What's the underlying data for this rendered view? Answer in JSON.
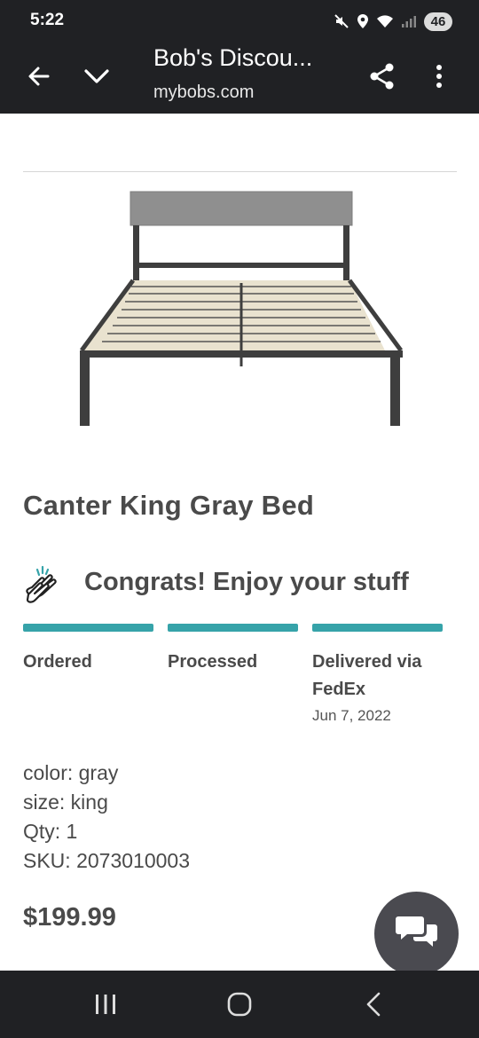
{
  "status_bar": {
    "time": "5:22",
    "battery": "46",
    "icons": [
      "mute-icon",
      "location-icon",
      "wifi-icon",
      "signal-icon"
    ]
  },
  "toolbar": {
    "title": "Bob's Discou...",
    "url": "mybobs.com",
    "icons": [
      "back-arrow-icon",
      "chevron-down-icon",
      "share-icon",
      "more-vert-icon"
    ]
  },
  "product": {
    "title": "Canter King Gray Bed",
    "image": "gray-platform-bed-frame"
  },
  "order_status": {
    "headline": "Congrats! Enjoy your stuff",
    "icon": "clapping-hands-icon",
    "steps": [
      {
        "label": "Ordered",
        "complete": true
      },
      {
        "label": "Processed",
        "complete": true
      },
      {
        "label": "Delivered via FedEx",
        "complete": true,
        "date": "Jun 7, 2022"
      }
    ],
    "accent_color": "#36a3a9"
  },
  "details": {
    "color": "color: gray",
    "size": "size: king",
    "qty": "Qty: 1",
    "sku": "SKU: 2073010003"
  },
  "price": "$199.99",
  "chat_button": {
    "icon": "chat-bubbles-icon"
  },
  "nav_bar": {
    "icons": [
      "recents-icon",
      "home-icon",
      "nav-back-icon"
    ]
  }
}
